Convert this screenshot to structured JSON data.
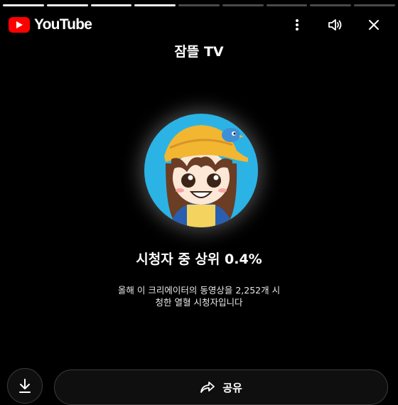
{
  "app": {
    "name": "YouTube"
  },
  "story_progress": {
    "total_segments": 9,
    "completed_segments": 4
  },
  "header": {
    "menu_icon": "more-vert-icon",
    "sound_icon": "volume-icon",
    "close_icon": "close-icon"
  },
  "channel": {
    "name": "잠뜰 TV"
  },
  "stat": {
    "headline": "시청자 중 상위 0.4%",
    "description_line1": "올해 이 크리에이터의 동영상을 2,252개 시",
    "description_line2": "청한 열혈 시청자입니다"
  },
  "actions": {
    "share_label": "공유",
    "share_icon": "share-arrow-icon",
    "download_icon": "download-icon"
  },
  "colors": {
    "brand_red": "#ff0000",
    "background": "#000000",
    "avatar_bg": "#2bb3e6"
  }
}
